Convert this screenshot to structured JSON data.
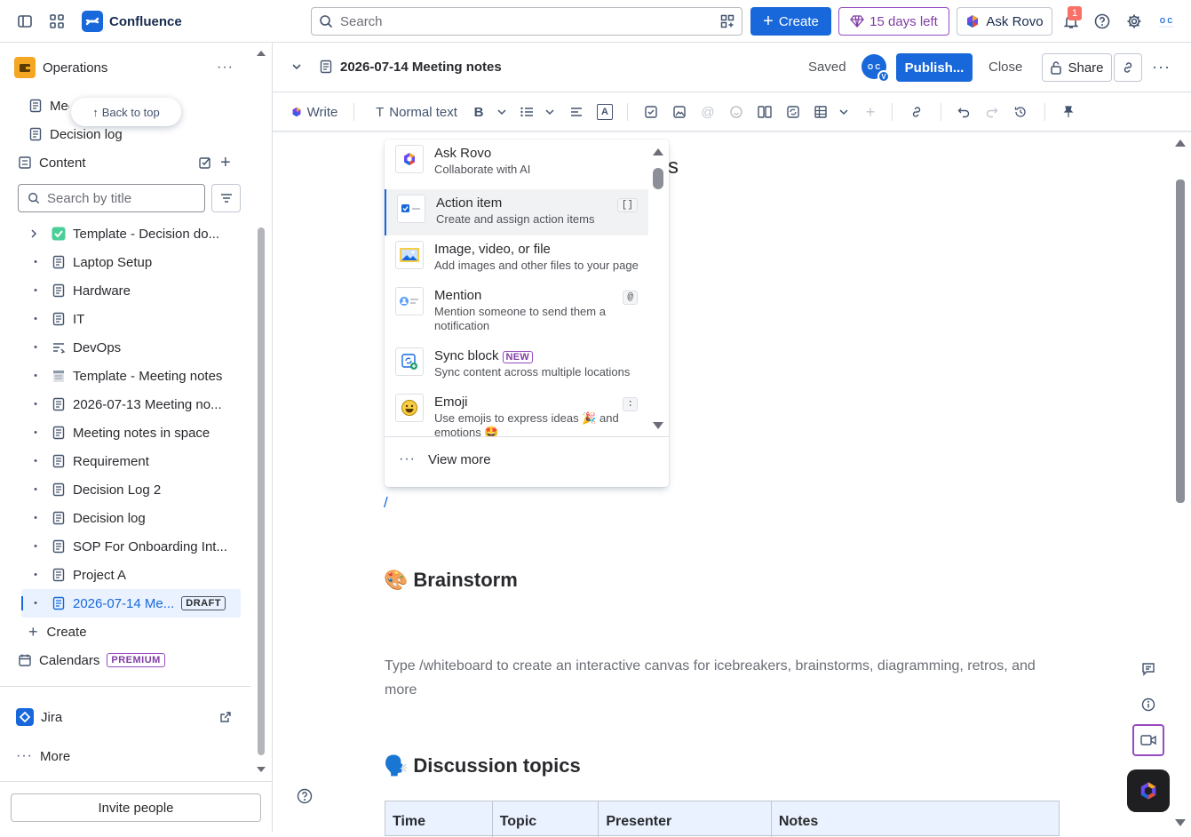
{
  "topnav": {
    "app_name": "Confluence",
    "search_placeholder": "Search",
    "create_label": "Create",
    "trial_label": "15 days left",
    "rovo_label": "Ask Rovo",
    "notification_count": "1"
  },
  "sidebar": {
    "space_name": "Operations",
    "pinned": [
      "Meeting notes in space",
      "Decision log"
    ],
    "back_to_top": "Back to top",
    "content_label": "Content",
    "search_placeholder": "Search by title",
    "tree": [
      {
        "label": "Template - Decision do...",
        "icon": "check-emoji-icon",
        "expand": true
      },
      {
        "label": "Laptop Setup",
        "icon": "page-icon"
      },
      {
        "label": "Hardware",
        "icon": "page-icon"
      },
      {
        "label": "IT",
        "icon": "page-icon"
      },
      {
        "label": "DevOps",
        "icon": "workflow-icon"
      },
      {
        "label": "Template - Meeting notes",
        "icon": "notepad-emoji-icon"
      },
      {
        "label": "2026-07-13 Meeting no...",
        "icon": "page-icon"
      },
      {
        "label": "Meeting notes in space",
        "icon": "page-icon"
      },
      {
        "label": "Requirement",
        "icon": "page-icon"
      },
      {
        "label": "Decision Log 2",
        "icon": "page-icon"
      },
      {
        "label": "Decision log",
        "icon": "page-icon"
      },
      {
        "label": "SOP For Onboarding Int...",
        "icon": "page-icon"
      },
      {
        "label": "Project A",
        "icon": "page-icon"
      },
      {
        "label": "2026-07-14 Me...",
        "icon": "page-icon",
        "active": true,
        "badge": "DRAFT"
      }
    ],
    "create_label": "Create",
    "calendars_label": "Calendars",
    "calendars_badge": "PREMIUM",
    "jira_label": "Jira",
    "more_label": "More",
    "invite_label": "Invite people"
  },
  "pagebar": {
    "title": "2026-07-14 Meeting notes",
    "status": "Saved",
    "avatar_initials": "O C",
    "avatar_badge": "V",
    "publish_label": "Publish...",
    "close_label": "Close",
    "share_label": "Share"
  },
  "toolbar": {
    "write_label": "Write",
    "text_style": "Normal text"
  },
  "insert_menu": {
    "items": [
      {
        "title": "Ask Rovo",
        "desc": "Collaborate with AI",
        "icon": "rovo-icon"
      },
      {
        "title": "Action item",
        "desc": "Create and assign action items",
        "shortcut": "[]",
        "icon": "action-item-icon",
        "selected": true
      },
      {
        "title": "Image, video, or file",
        "desc": "Add images and other files to your page",
        "icon": "image-icon"
      },
      {
        "title": "Mention",
        "desc": "Mention someone to send them a notification",
        "shortcut": "@",
        "icon": "mention-icon"
      },
      {
        "title": "Sync block",
        "badge": "NEW",
        "desc": "Sync content across multiple locations",
        "icon": "sync-block-icon"
      },
      {
        "title": "Emoji",
        "desc": "Use emojis to express ideas 🎉 and emotions 🤩",
        "shortcut": ":",
        "icon": "emoji-icon"
      }
    ],
    "view_more": "View more"
  },
  "editor": {
    "title_fragment": "s",
    "slash": "/",
    "brainstorm_heading": "Brainstorm",
    "brainstorm_emoji": "🎨",
    "brainstorm_placeholder": "Type /whiteboard to create an interactive canvas for icebreakers, brainstorms, diagramming, retros, and more",
    "discussion_heading": "Discussion topics",
    "discussion_emoji": "🗣️",
    "table_headers": [
      "Time",
      "Topic",
      "Presenter",
      "Notes"
    ]
  },
  "colors": {
    "brand_blue": "#1868db",
    "premium_purple": "#803fa5",
    "selected_bg": "#e9f2fe"
  }
}
